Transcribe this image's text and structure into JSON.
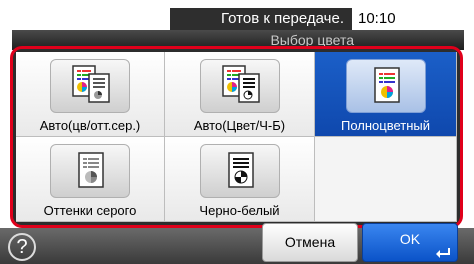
{
  "status": {
    "message": "Готов к передаче.",
    "time": "10:10"
  },
  "screen": {
    "title": "Выбор цвета"
  },
  "options": [
    {
      "label": "Авто(цв/отт.сер.)",
      "icon": "auto-color-grayscale-icon",
      "selected": false
    },
    {
      "label": "Авто(Цвет/Ч-Б)",
      "icon": "auto-color-bw-icon",
      "selected": false
    },
    {
      "label": "Полноцветный",
      "icon": "full-color-icon",
      "selected": true
    },
    {
      "label": "Оттенки серого",
      "icon": "grayscale-icon",
      "selected": false
    },
    {
      "label": "Черно-белый",
      "icon": "black-white-icon",
      "selected": false
    }
  ],
  "buttons": {
    "help": "?",
    "cancel": "Отмена",
    "ok": "OK"
  },
  "colors": {
    "selected": "#1b5fc8",
    "frame": "#e0001b",
    "ok": "#0b53c8"
  }
}
